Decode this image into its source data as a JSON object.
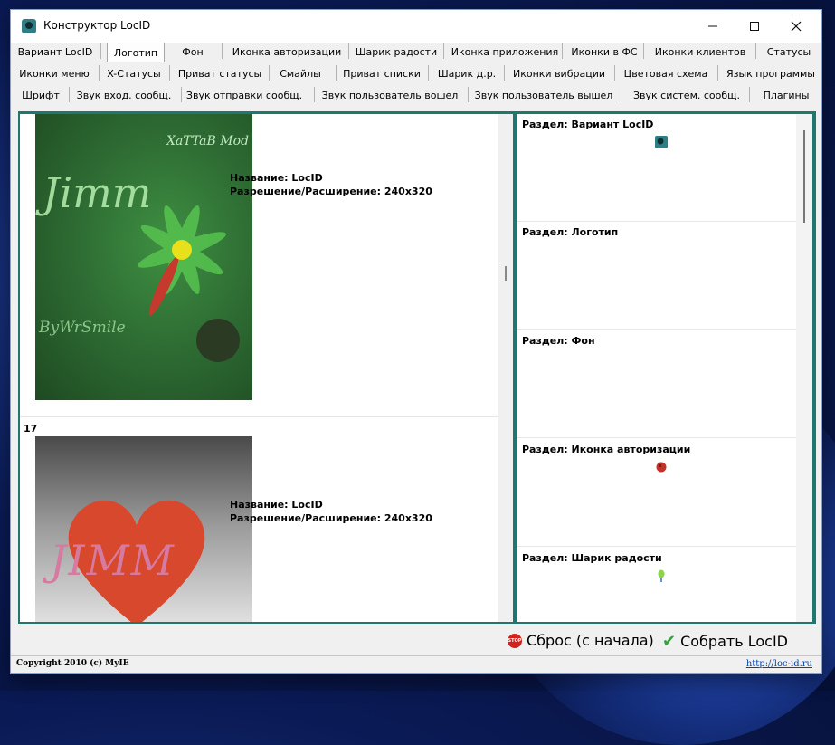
{
  "window": {
    "title": "Конструктор LocID"
  },
  "tabs": {
    "row1": [
      "Вариант LocID",
      "Логотип",
      "Фон",
      "Иконка авторизации",
      "Шарик радости",
      "Иконка приложения",
      "Иконки в ФС",
      "Иконки клиентов",
      "Статусы"
    ],
    "row2": [
      "Иконки меню",
      "X-Статусы",
      "Приват статусы",
      "Смайлы",
      "Приват списки",
      "Шарик д.р.",
      "Иконки вибрации",
      "Цветовая схема",
      "Язык программы"
    ],
    "row3": [
      "Шрифт",
      "Звук вход. сообщ.",
      "Звук отправки сообщ.",
      "Звук пользователь вошел",
      "Звук пользователь вышел",
      "Звук систем. сообщ.",
      "Плагины"
    ],
    "selected": "Логотип"
  },
  "items": [
    {
      "number": "",
      "brand_top": "XaTTaB Mod",
      "brand_main": "Jimm",
      "brand_bottom": "ByWrSmile",
      "name_line": "Название: LocID",
      "res_line": "Разрешение/Расширение: 240x320"
    },
    {
      "number": "17",
      "brand_main": "JIMM",
      "name_line": "Название: LocID",
      "res_line": "Разрешение/Расширение: 240x320"
    }
  ],
  "sections": [
    {
      "title": "Раздел: Вариант LocID",
      "icon": "locid-icon"
    },
    {
      "title": "Раздел: Логотип",
      "icon": ""
    },
    {
      "title": "Раздел: Фон",
      "icon": ""
    },
    {
      "title": "Раздел: Иконка авторизации",
      "icon": "auth-icon"
    },
    {
      "title": "Раздел: Шарик радости",
      "icon": "balloon-icon"
    }
  ],
  "actions": {
    "reset": "Сброс (с начала)",
    "build": "Собрать LocID",
    "stop_badge": "STOP"
  },
  "footer": {
    "copyright": "Copyright 2010 (c) MyIE",
    "link": "http://loc-id.ru"
  },
  "colors": {
    "frame": "#1f7770",
    "link": "#0645ad",
    "selected_tab_border": "#a5a5a5"
  }
}
